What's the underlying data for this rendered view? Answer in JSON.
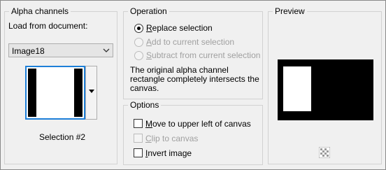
{
  "alpha_channels": {
    "title": "Alpha channels",
    "load_label": "Load from document:",
    "document": "Image18",
    "selection_name": "Selection #2"
  },
  "operation": {
    "title": "Operation",
    "options": [
      {
        "label": "Replace selection",
        "accel": "R",
        "selected": true,
        "enabled": true
      },
      {
        "label": "Add to current selection",
        "accel": "A",
        "selected": false,
        "enabled": false
      },
      {
        "label": "Subtract from current selection",
        "accel": "S",
        "selected": false,
        "enabled": false
      }
    ],
    "description": "The original alpha channel rectangle completely intersects the canvas."
  },
  "options_group": {
    "title": "Options",
    "items": [
      {
        "label": "Move to upper left of canvas",
        "accel": "M",
        "checked": false,
        "enabled": true
      },
      {
        "label": "Clip to canvas",
        "accel": "C",
        "checked": false,
        "enabled": false
      },
      {
        "label": "Invert image",
        "accel": "I",
        "checked": false,
        "enabled": true
      }
    ]
  },
  "preview": {
    "title": "Preview"
  },
  "colors": {
    "accent": "#1e7fd8",
    "disabled_text": "#a0a0a0"
  },
  "icons": [
    "chevron-down-icon",
    "dropdown-arrow-icon",
    "checkerboard-icon"
  ]
}
